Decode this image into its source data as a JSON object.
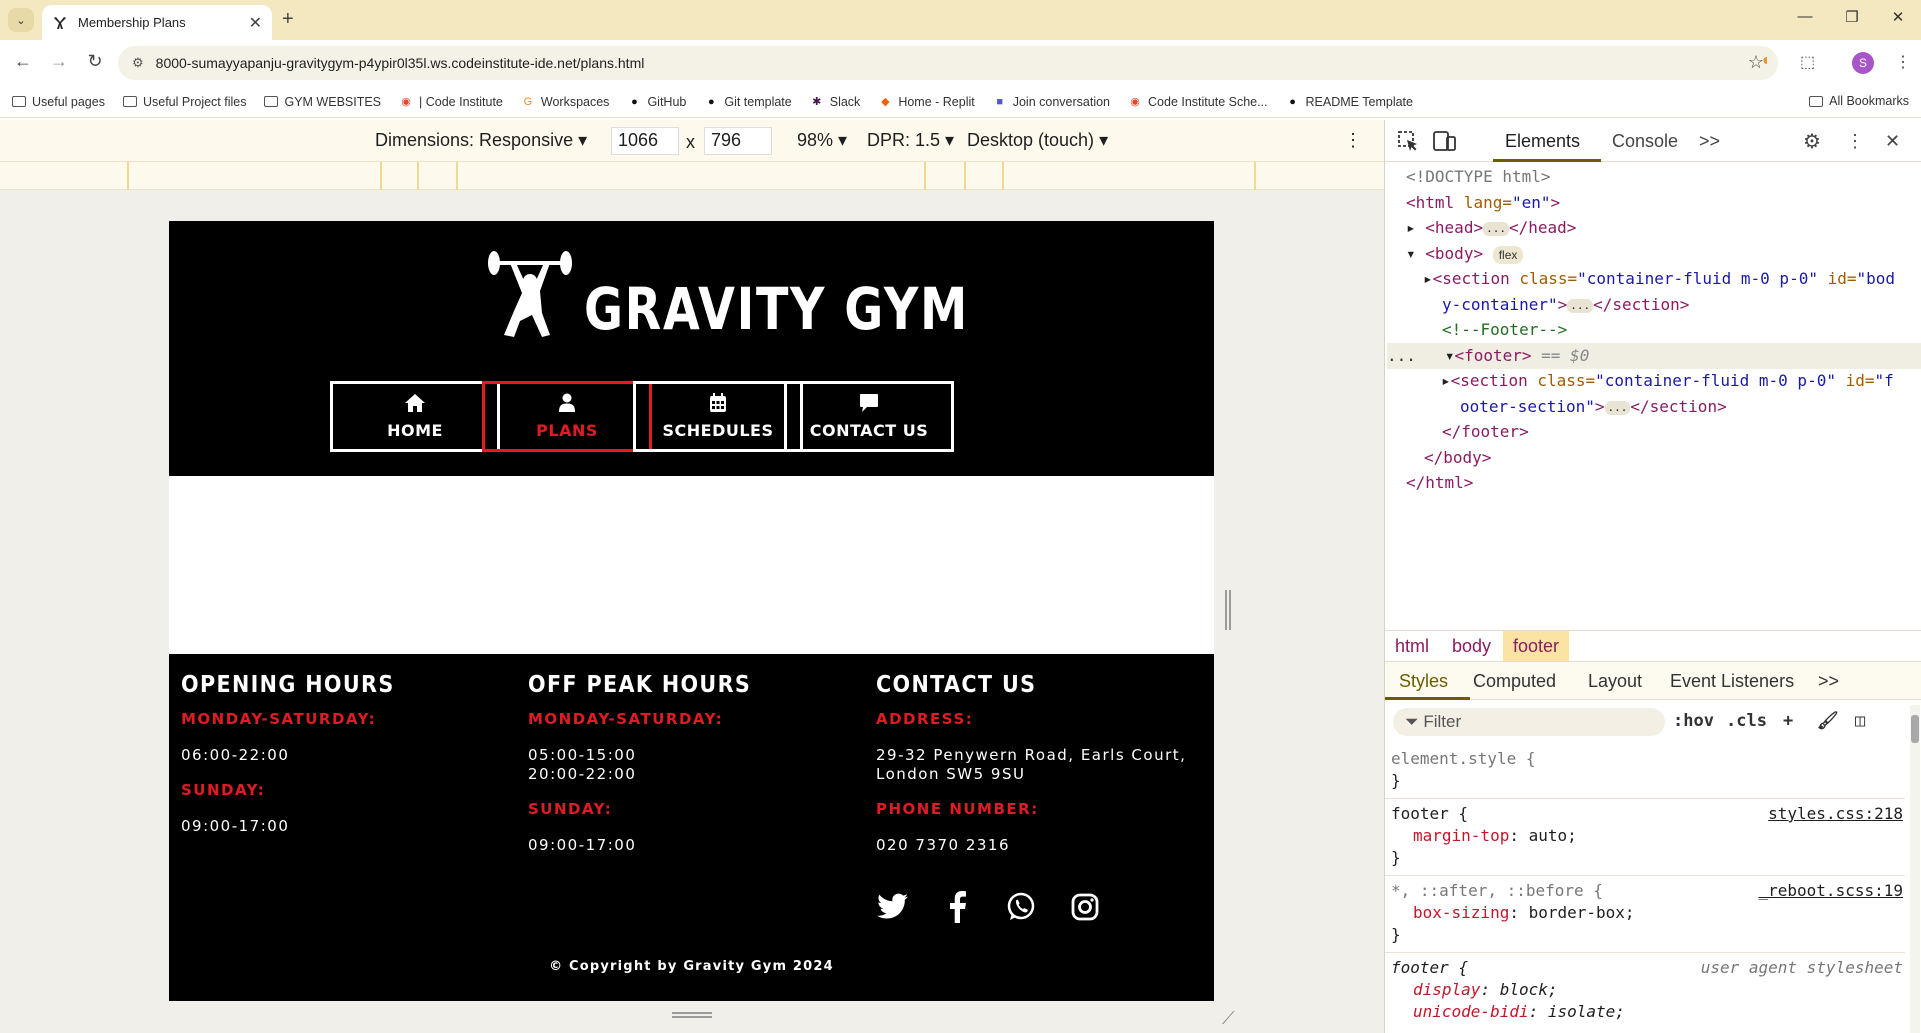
{
  "browser": {
    "tab_title": "Membership Plans",
    "url": "8000-sumayyapanju-gravitygym-p4ypir0l35l.ws.codeinstitute-ide.net/plans.html",
    "profile_initial": "S",
    "bookmarks": [
      {
        "label": "Useful pages",
        "icon": "folder-icon"
      },
      {
        "label": "Useful Project files",
        "icon": "folder-icon"
      },
      {
        "label": "GYM WEBSITES",
        "icon": "folder-icon"
      },
      {
        "label": "| Code Institute",
        "icon": "code-institute-icon"
      },
      {
        "label": "Workspaces",
        "icon": "workspaces-icon"
      },
      {
        "label": "GitHub",
        "icon": "github-icon"
      },
      {
        "label": "Git template",
        "icon": "github-icon"
      },
      {
        "label": "Slack",
        "icon": "slack-icon"
      },
      {
        "label": "Home - Replit",
        "icon": "replit-icon"
      },
      {
        "label": "Join conversation",
        "icon": "teams-icon"
      },
      {
        "label": "Code Institute Sche...",
        "icon": "code-institute-icon"
      },
      {
        "label": "README Template",
        "icon": "github-icon"
      }
    ],
    "all_bookmarks": "All Bookmarks"
  },
  "device_toolbar": {
    "dimensions_label": "Dimensions: Responsive",
    "width": "1066",
    "times": "x",
    "height": "796",
    "zoom": "98%",
    "dpr": "DPR: 1.5",
    "device_type": "Desktop (touch)"
  },
  "site": {
    "brand": "GRAVITY GYM",
    "nav": [
      {
        "label": "HOME",
        "icon": "home-icon",
        "active": false
      },
      {
        "label": "PLANS",
        "icon": "user-icon",
        "active": true
      },
      {
        "label": "SCHEDULES",
        "icon": "calendar-icon",
        "active": false
      },
      {
        "label": "CONTACT US",
        "icon": "chat-icon",
        "active": false
      }
    ],
    "footer": {
      "opening": {
        "heading": "OPENING HOURS",
        "label1": "MONDAY-SATURDAY:",
        "value1": "06:00-22:00",
        "label2": "SUNDAY:",
        "value2": "09:00-17:00"
      },
      "offpeak": {
        "heading": "OFF PEAK HOURS",
        "label1": "MONDAY-SATURDAY:",
        "value1": "05:00-15:00\n20:00-22:00",
        "label2": "SUNDAY:",
        "value2": "09:00-17:00"
      },
      "contact": {
        "heading": "CONTACT US",
        "label1": "ADDRESS:",
        "value1": "29-32 Penywern Road, Earls Court,\nLondon SW5 9SU",
        "label2": "PHONE NUMBER:",
        "value2": "020 7370 2316"
      },
      "socials": [
        "twitter-icon",
        "facebook-icon",
        "whatsapp-icon",
        "instagram-icon"
      ],
      "copyright": "© Copyright by Gravity Gym 2024"
    }
  },
  "devtools": {
    "tabs": {
      "elements": "Elements",
      "console": "Console",
      "more": ">>"
    },
    "dom": {
      "doctype": "<!DOCTYPE html>",
      "html_open_tag": "<html",
      "lang_attr": " lang=",
      "lang_val": "\"en\"",
      "head_open": "<head>",
      "head_close": "</head>",
      "body_open": "<body>",
      "flex_badge": "flex",
      "section_open": "<section",
      "class_attr": " class=",
      "class_val": "\"container-fluid m-0 p-0\"",
      "id_attr": " id=",
      "id_val_1a": "\"bod",
      "id_val_1b": "y-container\"",
      "section_close": "</section>",
      "comment": "<!--Footer-->",
      "footer_open": "<footer>",
      "footer_eq": "== $0",
      "id_val_2a": "\"f",
      "id_val_2b": "ooter-section\"",
      "footer_close": "</footer>",
      "body_close": "</body>",
      "html_close": "</html>",
      "dots": "...",
      "gt": ">"
    },
    "breadcrumbs": [
      "html",
      "body",
      "footer"
    ],
    "style_tabs": [
      "Styles",
      "Computed",
      "Layout",
      "Event Listeners",
      ">>"
    ],
    "filter_placeholder": "Filter",
    "hov": ":hov",
    "cls": ".cls",
    "rules": {
      "r1_selector": "element.style {",
      "r1_close": "}",
      "r2_selector": "footer {",
      "r2_source": "styles.css:218",
      "r2_prop": "margin-top",
      "r2_value": " auto;",
      "r2_close": "}",
      "r3_selector": "*, ::after, ::before {",
      "r3_source": "_reboot.scss:19",
      "r3_prop": "box-sizing",
      "r3_value": " border-box;",
      "r3_close": "}",
      "r4_selector": "footer {",
      "r4_source": "user agent stylesheet",
      "r4_prop1": "display",
      "r4_value1": " block;",
      "r4_prop2": "unicode-bidi",
      "r4_value2": " isolate;",
      "colon": ":"
    }
  }
}
